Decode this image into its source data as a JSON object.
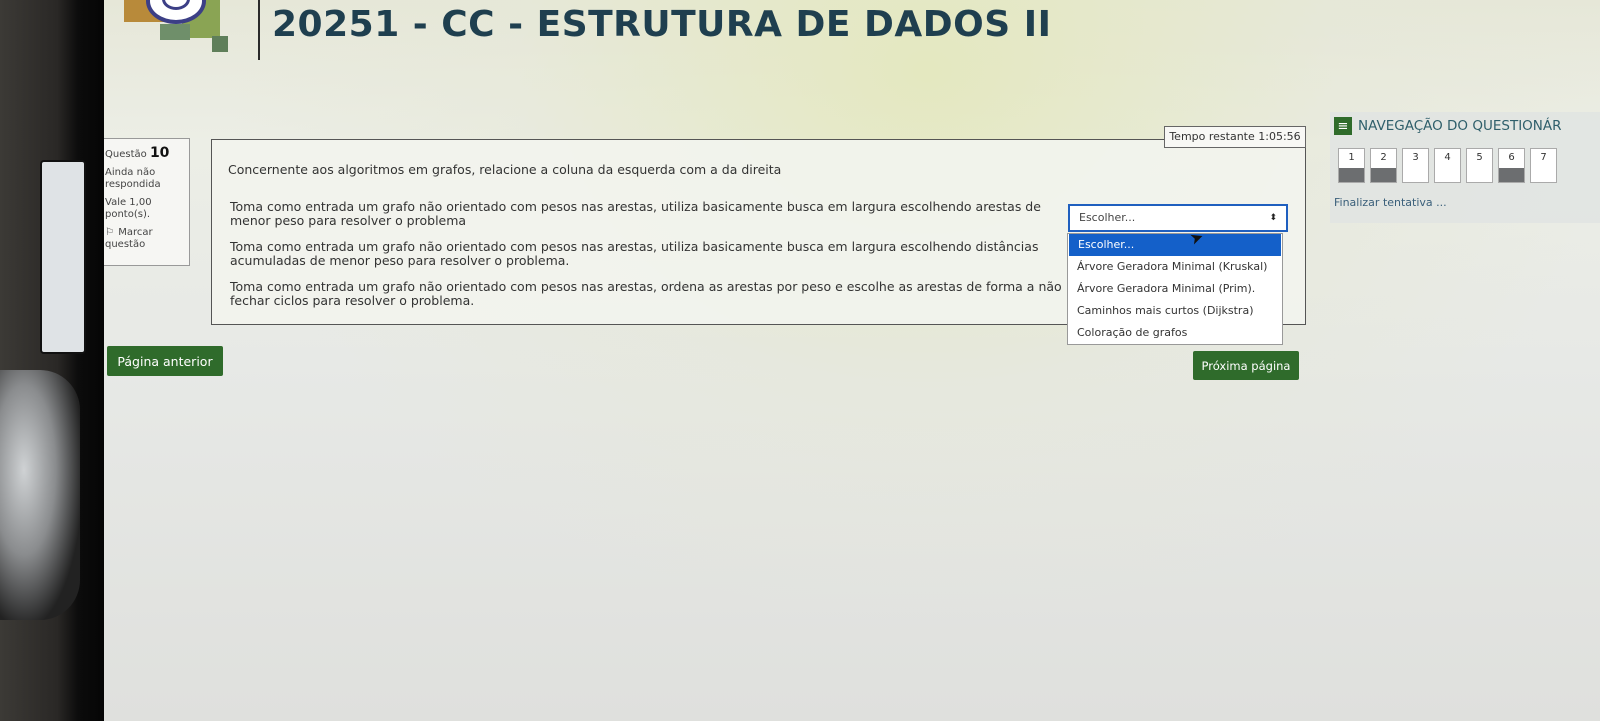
{
  "header": {
    "course_title": "20251 - CC - ESTRUTURA DE DADOS II"
  },
  "question_info": {
    "label": "Questão",
    "number": "10",
    "status": "Ainda não respondida",
    "grade": "Vale 1,00 ponto(s).",
    "flag_label": "Marcar questão"
  },
  "question": {
    "prompt": "Concernente aos algoritmos em grafos, relacione a coluna da esquerda com a da direita",
    "items": [
      "Toma como entrada um grafo não orientado com pesos nas arestas, utiliza basicamente busca em largura escolhendo arestas de menor peso para resolver o problema",
      "Toma como entrada um grafo não orientado com pesos nas arestas, utiliza basicamente busca em largura escolhendo distâncias acumuladas de menor peso para resolver o problema.",
      "Toma como entrada um grafo não orientado com pesos nas arestas, ordena as arestas por peso e escolhe as arestas de forma a não fechar ciclos para resolver o problema."
    ]
  },
  "select": {
    "current_value": "Escolher...",
    "options": [
      "Escolher...",
      "Árvore Geradora Minimal (Kruskal)",
      "Árvore Geradora Minimal (Prim).",
      "Caminhos mais curtos (Dijkstra)",
      "Coloração de grafos"
    ]
  },
  "timer": {
    "text": "Tempo restante 1:05:56"
  },
  "buttons": {
    "prev": "Página anterior",
    "next": "Próxima página"
  },
  "quiz_nav": {
    "title": "NAVEGAÇÃO DO QUESTIONÁR",
    "questions": [
      {
        "label": "1",
        "answered": true
      },
      {
        "label": "2",
        "answered": true
      },
      {
        "label": "3",
        "answered": false
      },
      {
        "label": "4",
        "answered": false
      },
      {
        "label": "5",
        "answered": false
      },
      {
        "label": "6",
        "answered": true
      },
      {
        "label": "7",
        "answered": false
      }
    ],
    "finish_link": "Finalizar tentativa ..."
  },
  "colors": {
    "button_green": "#2f6b2b",
    "select_focus_blue": "#1f5fbf",
    "dropdown_highlight": "#1460c9",
    "title_color": "#1f3f4f"
  }
}
